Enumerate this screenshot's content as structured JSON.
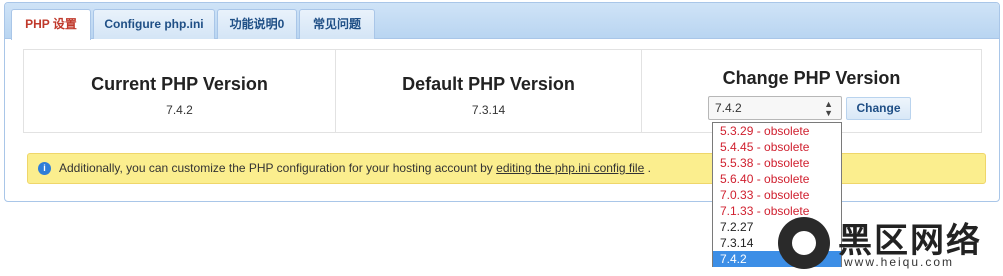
{
  "tabs": [
    {
      "label": "PHP 设置",
      "active": true
    },
    {
      "label": "Configure php.ini",
      "active": false
    },
    {
      "label": "功能说明0",
      "active": false
    },
    {
      "label": "常见问题",
      "active": false
    }
  ],
  "current": {
    "title": "Current PHP Version",
    "value": "7.4.2"
  },
  "default": {
    "title": "Default PHP Version",
    "value": "7.3.14"
  },
  "change": {
    "title": "Change PHP Version",
    "selected": "7.4.2",
    "button": "Change"
  },
  "dropdown_options": [
    {
      "label": "5.3.29 - obsolete",
      "status": "obsolete"
    },
    {
      "label": "5.4.45 - obsolete",
      "status": "obsolete"
    },
    {
      "label": "5.5.38 - obsolete",
      "status": "obsolete"
    },
    {
      "label": "5.6.40 - obsolete",
      "status": "obsolete"
    },
    {
      "label": "7.0.33 - obsolete",
      "status": "obsolete"
    },
    {
      "label": "7.1.33 - obsolete",
      "status": "obsolete"
    },
    {
      "label": "7.2.27",
      "status": "current"
    },
    {
      "label": "7.3.14",
      "status": "current"
    },
    {
      "label": "7.4.2",
      "status": "selected"
    }
  ],
  "notice": {
    "icon": "info-icon",
    "prefix": "Additionally, you can customize the PHP configuration for your hosting account by",
    "link": "editing the php.ini config file",
    "suffix": "."
  },
  "watermark": {
    "title": "黑区网络",
    "url": "www.heiqu.com"
  },
  "colors": {
    "accent": "#1f4f86",
    "active_tab": "#c0392b",
    "obsolete": "#d0202f",
    "selection": "#3c8ee6",
    "notice_bg": "#fbee8e"
  }
}
